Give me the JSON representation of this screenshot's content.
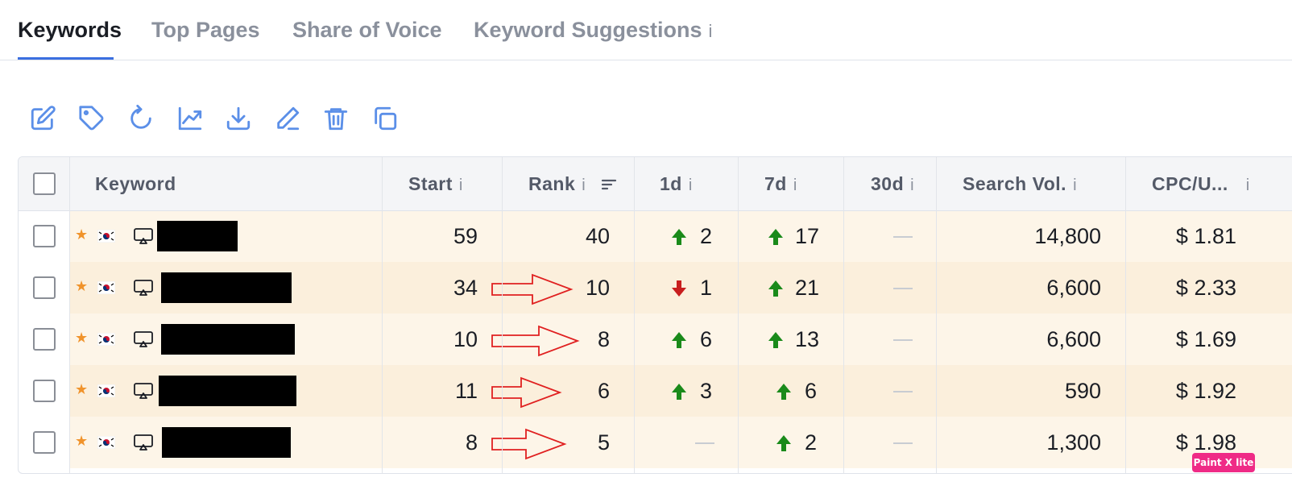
{
  "tabs": [
    {
      "label": "Keywords",
      "active": true
    },
    {
      "label": "Top Pages",
      "active": false
    },
    {
      "label": "Share of Voice",
      "active": false
    },
    {
      "label": "Keyword Suggestions",
      "active": false,
      "info": "i"
    }
  ],
  "toolbar": {
    "icons": [
      "edit-icon",
      "tag-icon",
      "refresh-icon",
      "chart-icon",
      "download-icon",
      "pencil-icon",
      "trash-icon",
      "copy-icon"
    ]
  },
  "table": {
    "headers": {
      "keyword": "Keyword",
      "start": "Start",
      "rank": "Rank",
      "d1": "1d",
      "d7": "7d",
      "d30": "30d",
      "search_vol": "Search Vol.",
      "cpc": "CPC/U...",
      "info": "i"
    },
    "rows": [
      {
        "start": "59",
        "rank": "40",
        "d1": "2",
        "d1_dir": "up",
        "d7": "17",
        "d7_dir": "up",
        "d30": "",
        "search_vol": "14,800",
        "cpc": "$ 1.81"
      },
      {
        "start": "34",
        "rank": "10",
        "d1": "1",
        "d1_dir": "down",
        "d7": "21",
        "d7_dir": "up",
        "d30": "",
        "search_vol": "6,600",
        "cpc": "$ 2.33"
      },
      {
        "start": "10",
        "rank": "8",
        "d1": "6",
        "d1_dir": "up",
        "d7": "13",
        "d7_dir": "up",
        "d30": "",
        "search_vol": "6,600",
        "cpc": "$ 1.69"
      },
      {
        "start": "11",
        "rank": "6",
        "d1": "3",
        "d1_dir": "up",
        "d7": "6",
        "d7_dir": "up",
        "d30": "",
        "search_vol": "590",
        "cpc": "$ 1.92"
      },
      {
        "start": "8",
        "rank": "5",
        "d1": "",
        "d1_dir": "none",
        "d7": "2",
        "d7_dir": "up",
        "d30": "",
        "search_vol": "1,300",
        "cpc": "$ 1.98"
      }
    ]
  },
  "colors": {
    "accent": "#3b6fe0",
    "up": "#1a8a1a",
    "down": "#c81e1e",
    "row_odd": "#fdf5e8",
    "row_even": "#fbefdc",
    "annotation": "#e02020"
  },
  "watermark": "Paint X lite"
}
